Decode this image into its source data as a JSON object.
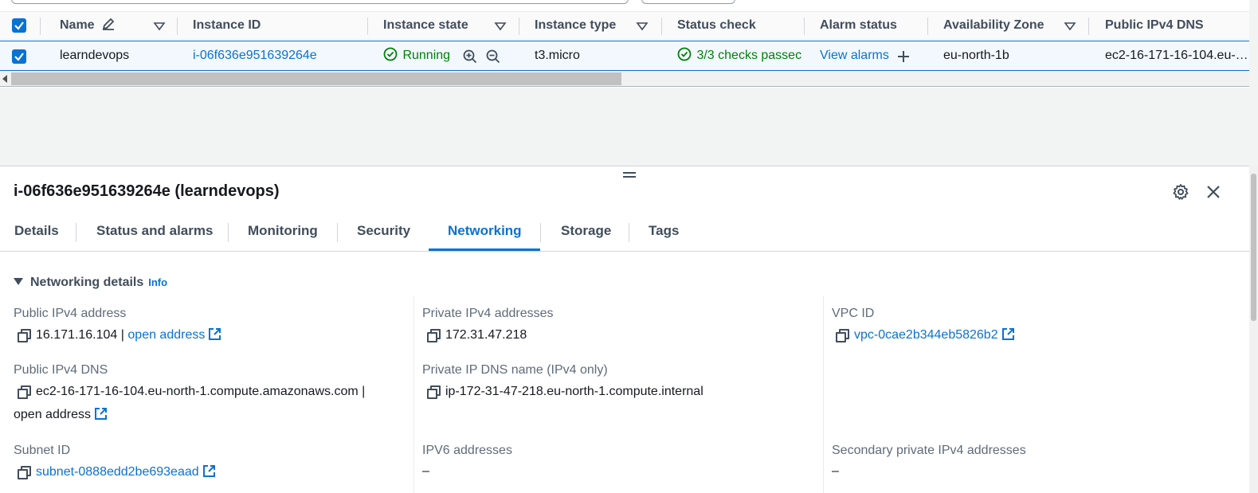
{
  "table": {
    "columns": [
      "Name",
      "Instance ID",
      "Instance state",
      "Instance type",
      "Status check",
      "Alarm status",
      "Availability Zone",
      "Public IPv4 DNS"
    ],
    "row": {
      "name": "learndevops",
      "instance_id": "i-06f636e951639264e",
      "state": "Running",
      "type": "t3.micro",
      "status_check": "3/3 checks passec",
      "alarm_status": "View alarms",
      "az": "eu-north-1b",
      "public_dns": "ec2-16-171-16-104.eu-…"
    }
  },
  "panel": {
    "title": "i-06f636e951639264e (learndevops)",
    "tabs": [
      "Details",
      "Status and alarms",
      "Monitoring",
      "Security",
      "Networking",
      "Storage",
      "Tags"
    ],
    "active_tab": "Networking",
    "section_title": "Networking details",
    "info_label": "Info",
    "fields": {
      "public_ipv4_label": "Public IPv4 address",
      "public_ipv4_value": "16.171.16.104",
      "separator": "|",
      "open_address": "open address",
      "private_ipv4_label": "Private IPv4 addresses",
      "private_ipv4_value": "172.31.47.218",
      "vpc_label": "VPC ID",
      "vpc_value": "vpc-0cae2b344eb5826b2",
      "public_dns_label": "Public IPv4 DNS",
      "public_dns_value": "ec2-16-171-16-104.eu-north-1.compute.amazonaws.com",
      "private_dns_label": "Private IP DNS name (IPv4 only)",
      "private_dns_value": "ip-172-31-47-218.eu-north-1.compute.internal",
      "subnet_label": "Subnet ID",
      "subnet_value": "subnet-0888edd2be693eaad",
      "ipv6_label": "IPV6 addresses",
      "ipv6_value": "–",
      "secondary_label": "Secondary private IPv4 addresses",
      "secondary_value": "–"
    }
  },
  "colors": {
    "accent": "#0972d3",
    "success": "#037f0c",
    "text": "#16191f",
    "muted": "#5f6b7a"
  }
}
